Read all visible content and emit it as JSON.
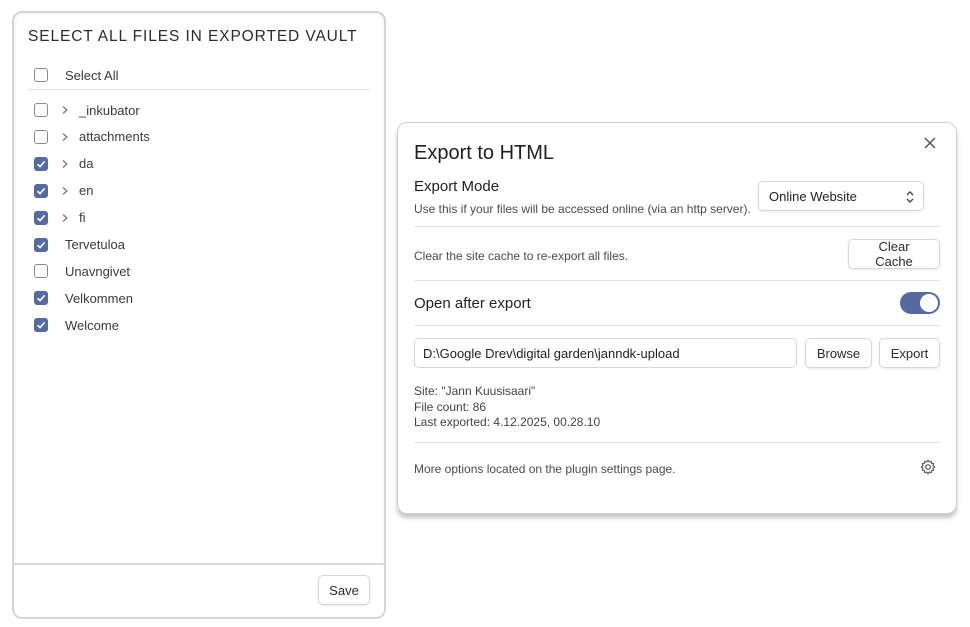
{
  "file_tree": {
    "title": "SELECT ALL FILES IN EXPORTED VAULT",
    "select_all": {
      "label": "Select All",
      "checked": false
    },
    "items": [
      {
        "label": "_inkubator",
        "checked": false,
        "folder": true
      },
      {
        "label": "attachments",
        "checked": false,
        "folder": true
      },
      {
        "label": "da",
        "checked": true,
        "folder": true
      },
      {
        "label": "en",
        "checked": true,
        "folder": true
      },
      {
        "label": "fi",
        "checked": true,
        "folder": true
      },
      {
        "label": "Tervetuloa",
        "checked": true,
        "folder": false
      },
      {
        "label": "Unavngivet",
        "checked": false,
        "folder": false
      },
      {
        "label": "Velkommen",
        "checked": true,
        "folder": false
      },
      {
        "label": "Welcome",
        "checked": true,
        "folder": false
      }
    ],
    "save_label": "Save"
  },
  "export_modal": {
    "title": "Export to HTML",
    "export_mode": {
      "name": "Export Mode",
      "description": "Use this if your files will be accessed online (via an http server).",
      "selected": "Online Website"
    },
    "cache": {
      "description": "Clear the site cache to re-export all files.",
      "button_label": "Clear Cache"
    },
    "open_after_export": {
      "name": "Open after export",
      "enabled": true
    },
    "path": {
      "value": "D:\\Google Drev\\digital garden\\janndk-upload",
      "browse_label": "Browse",
      "export_label": "Export"
    },
    "info": {
      "site": "Site: \"Jann Kuusisaari\"",
      "file_count": "File count: 86",
      "last_exported": "Last exported: 4.12.2025, 00.28.10"
    },
    "footer_text": "More options located on the plugin settings page."
  },
  "colors": {
    "accent": "#566a9f",
    "border": "#d6d6d6"
  },
  "icons": {
    "close": "close-icon",
    "chevron": "chevron-right-icon",
    "dropdown": "updown-icon",
    "settings": "gear-icon",
    "check": "checkmark-icon"
  }
}
